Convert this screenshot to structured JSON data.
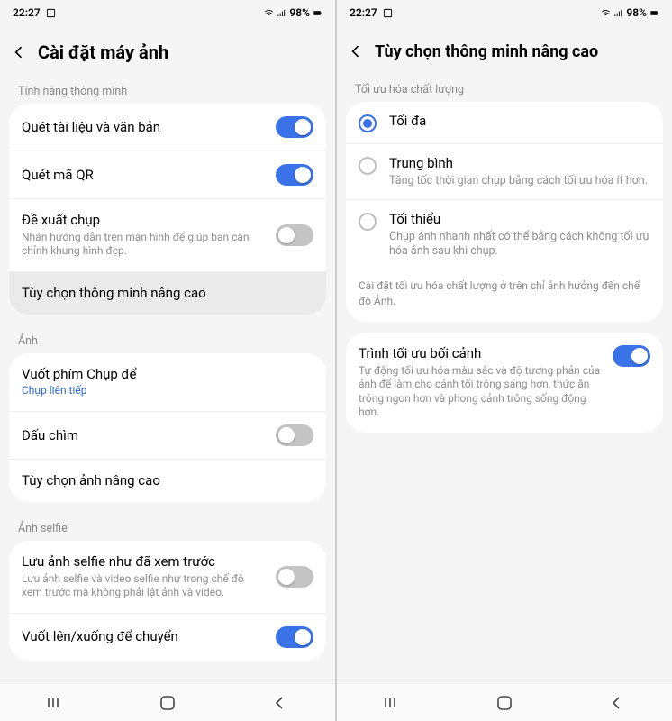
{
  "status": {
    "time": "22:27",
    "battery": "98%"
  },
  "left": {
    "title": "Cài đặt máy ảnh",
    "sec1": "Tính năng thông minh",
    "sec2": "Ảnh",
    "sec3": "Ảnh selfie",
    "items": {
      "scan_docs": "Quét tài liệu và văn bản",
      "scan_qr": "Quét mã QR",
      "shot_suggest": "Đề xuất chụp",
      "shot_suggest_sub": "Nhận hướng dẫn trên màn hình để giúp bạn căn chỉnh khung hình đẹp.",
      "adv_intel": "Tùy chọn thông minh nâng cao",
      "swipe_shutter": "Vuốt phím Chụp để",
      "swipe_shutter_sub": "Chụp liên tiếp",
      "watermark": "Dấu chìm",
      "adv_pic": "Tùy chọn ảnh nâng cao",
      "selfie_save": "Lưu ảnh selfie như đã xem trước",
      "selfie_save_sub": "Lưu ảnh selfie và video selfie như trong chế độ xem trước mà không phải lật ảnh và video.",
      "swipe_switch": "Vuốt lên/xuống để chuyển"
    }
  },
  "right": {
    "title": "Tùy chọn thông minh nâng cao",
    "sec1": "Tối ưu hóa chất lượng",
    "radios": {
      "max": "Tối đa",
      "med": "Trung bình",
      "med_sub": "Tăng tốc thời gian chụp bằng cách tối ưu hóa ít hơn.",
      "min": "Tối thiểu",
      "min_sub": "Chụp ảnh nhanh nhất có thể bằng cách không tối ưu hóa ảnh sau khi chụp."
    },
    "note": "Cài đặt tối ưu hóa chất lượng ở trên chỉ ảnh hưởng đến chế độ Ảnh.",
    "scene": "Trình tối ưu bối cảnh",
    "scene_sub": "Tự động tối ưu hóa màu sắc và độ tương phản của ảnh để làm cho cảnh tối trông sáng hơn, thức ăn trông ngon hơn và phong cảnh trông sống động hơn."
  }
}
